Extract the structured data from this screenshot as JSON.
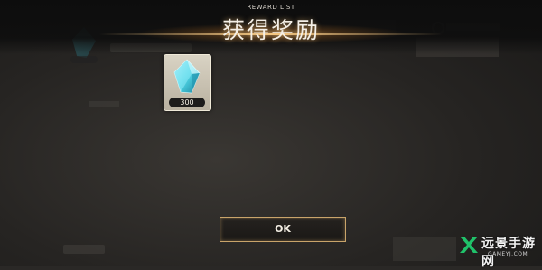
{
  "header": {
    "subtitle": "REWARD LIST",
    "title": "获得奖励"
  },
  "reward": {
    "item_icon": "blue-crystal-icon",
    "quantity": "300"
  },
  "actions": {
    "ok_label": "OK"
  },
  "watermark": {
    "title": "远景手游网",
    "subtitle": "GAMEYJ.COM"
  },
  "colors": {
    "accent_gold": "#c9a46a",
    "crystal_cyan": "#4fd6e6"
  }
}
